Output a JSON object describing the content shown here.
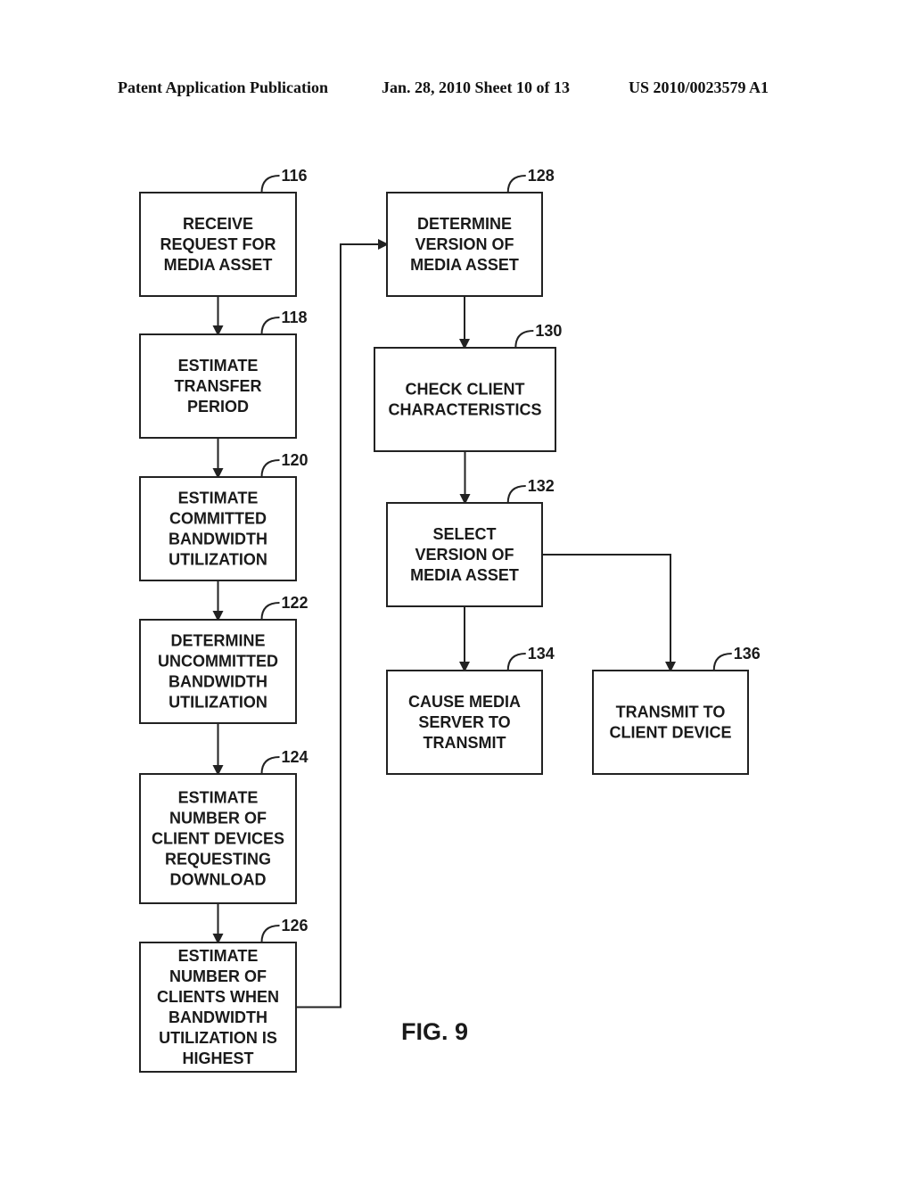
{
  "header": {
    "left": "Patent Application Publication",
    "middle": "Jan. 28, 2010  Sheet 10 of 13",
    "right": "US 2010/0023579 A1"
  },
  "figure_label": "FIG. 9",
  "steps": [
    {
      "ref": "116",
      "lines": [
        "RECEIVE",
        "REQUEST FOR",
        "MEDIA ASSET"
      ]
    },
    {
      "ref": "118",
      "lines": [
        "ESTIMATE",
        "TRANSFER",
        "PERIOD"
      ]
    },
    {
      "ref": "120",
      "lines": [
        "ESTIMATE",
        "COMMITTED",
        "BANDWIDTH",
        "UTILIZATION"
      ]
    },
    {
      "ref": "122",
      "lines": [
        "DETERMINE",
        "UNCOMMITTED",
        "BANDWIDTH",
        "UTILIZATION"
      ]
    },
    {
      "ref": "124",
      "lines": [
        "ESTIMATE",
        "NUMBER OF",
        "CLIENT DEVICES",
        "REQUESTING",
        "DOWNLOAD"
      ]
    },
    {
      "ref": "126",
      "lines": [
        "ESTIMATE",
        "NUMBER OF",
        "CLIENTS WHEN",
        "BANDWIDTH",
        "UTILIZATION IS",
        "HIGHEST"
      ]
    },
    {
      "ref": "128",
      "lines": [
        "DETERMINE",
        "VERSION OF",
        "MEDIA ASSET"
      ]
    },
    {
      "ref": "130",
      "lines": [
        "CHECK CLIENT",
        "CHARACTERISTICS"
      ]
    },
    {
      "ref": "132",
      "lines": [
        "SELECT",
        "VERSION OF",
        "MEDIA ASSET"
      ]
    },
    {
      "ref": "134",
      "lines": [
        "CAUSE MEDIA",
        "SERVER TO",
        "TRANSMIT"
      ]
    },
    {
      "ref": "136",
      "lines": [
        "TRANSMIT TO",
        "CLIENT DEVICE"
      ]
    }
  ],
  "connections": [
    [
      "116",
      "118"
    ],
    [
      "118",
      "120"
    ],
    [
      "120",
      "122"
    ],
    [
      "122",
      "124"
    ],
    [
      "124",
      "126"
    ],
    [
      "126",
      "128"
    ],
    [
      "128",
      "130"
    ],
    [
      "130",
      "132"
    ],
    [
      "132",
      "134"
    ],
    [
      "132",
      "136"
    ]
  ]
}
